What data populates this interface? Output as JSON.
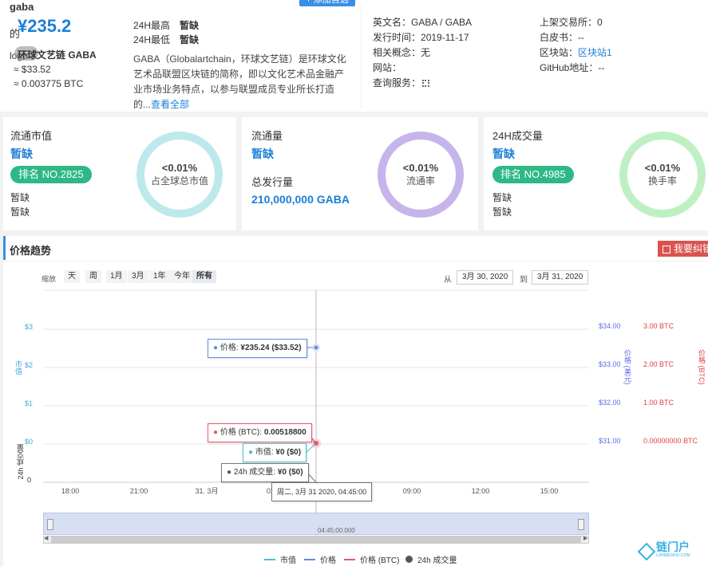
{
  "coin": {
    "name": "gaba",
    "logo_prefix": "的",
    "logo_alt": "logo",
    "price_cny": "¥235.2",
    "full_name": "环球文艺链 GABA",
    "badge": "0",
    "price_usd": "≈ $33.52",
    "price_btc": "≈ 0.003775 BTC",
    "add_button": "+ 添加自选",
    "high_label": "24H最高",
    "high_value": "暂缺",
    "low_label": "24H最低",
    "low_value": "暂缺",
    "desc": "GABA（Globalartchain，环球文艺链）是环球文化艺术品联盟区块链的简称，即以文化艺术品金融产业市场业务特点，以参与联盟成员专业所长打造的...",
    "desc_more": "查看全部"
  },
  "info": {
    "en_name_label": "英文名：",
    "en_name": "GABA / GABA",
    "issue_label": "发行时间：",
    "issue": "2019-11-17",
    "concept_label": "相关概念：",
    "concept": "无",
    "website_label": "网站：",
    "query_label": "查询服务：",
    "exch_label": "上架交易所：",
    "exch": "0",
    "whitepaper_label": "白皮书：",
    "whitepaper": "--",
    "block_label": "区块站：",
    "block": "区块站1",
    "github_label": "GitHub地址：",
    "github": "--"
  },
  "stats": [
    {
      "title": "流通市值",
      "value": "暂缺",
      "rank": "排名 NO.2825",
      "l1": "暂缺",
      "l2": "暂缺",
      "pct": "<0.01%",
      "pct_label": "占全球总市值",
      "color": "#bde9ec"
    },
    {
      "title": "流通量",
      "value": "暂缺",
      "sub_label": "总发行量",
      "sub_value": "210,000,000 GABA",
      "pct": "<0.01%",
      "pct_label": "流通率",
      "color": "#c6b4ea"
    },
    {
      "title": "24H成交量",
      "value": "暂缺",
      "rank": "排名 NO.4985",
      "l1": "暂缺",
      "l2": "暂缺",
      "pct": "<0.01%",
      "pct_label": "换手率",
      "color": "#bff0c4"
    }
  ],
  "trend": {
    "title": "价格趋势",
    "report": "我要纠错",
    "zoom_label": "缩放",
    "ranges": [
      "天",
      "周",
      "1月",
      "3月",
      "1年",
      "今年",
      "所有"
    ],
    "active_range": "所有",
    "from_label": "从",
    "from": "3月 30, 2020",
    "to_label": "到",
    "to": "3月 31, 2020",
    "brush_label": "04:45:00.000"
  },
  "chart_data": {
    "type": "line",
    "left_axis": {
      "label": "市值",
      "ticks": [
        "$3",
        "$2",
        "$1",
        "$0"
      ]
    },
    "volume_axis": {
      "label": "24h 成交量",
      "ticks": [
        "0"
      ]
    },
    "usd_axis": {
      "label": "价格 (美元)",
      "ticks": [
        "$34.00",
        "$33.00",
        "$32.00",
        "$31.00"
      ]
    },
    "btc_axis": {
      "label": "价格 (BTC)",
      "ticks": [
        "3.00 BTC",
        "2.00 BTC",
        "1.00 BTC",
        "0.00000000 BTC"
      ]
    },
    "x_ticks": [
      "18:00",
      "21:00",
      "31. 3月",
      "03:00",
      "06:00",
      "09:00",
      "12:00",
      "15:00"
    ],
    "tooltips": {
      "price_label": "价格: ",
      "price_value": "¥235.24 ($33.52)",
      "btc_label": "价格 (BTC): ",
      "btc_value": "0.00518800",
      "mcap_label": "市值: ",
      "mcap_value": "¥0 ($0)",
      "vol_label": "24h 成交量: ",
      "vol_value": "¥0 ($0)",
      "time": "周二, 3月 31 2020, 04:45:00"
    },
    "series": [
      {
        "name": "市值",
        "color": "#44c3d3"
      },
      {
        "name": "价格",
        "color": "#5b8ee6"
      },
      {
        "name": "价格 (BTC)",
        "color": "#e8566a"
      },
      {
        "name": "24h 成交量",
        "color": "#555555"
      }
    ]
  },
  "watermark": {
    "name": "链门户",
    "sub": "LIANMENHU.COM"
  }
}
